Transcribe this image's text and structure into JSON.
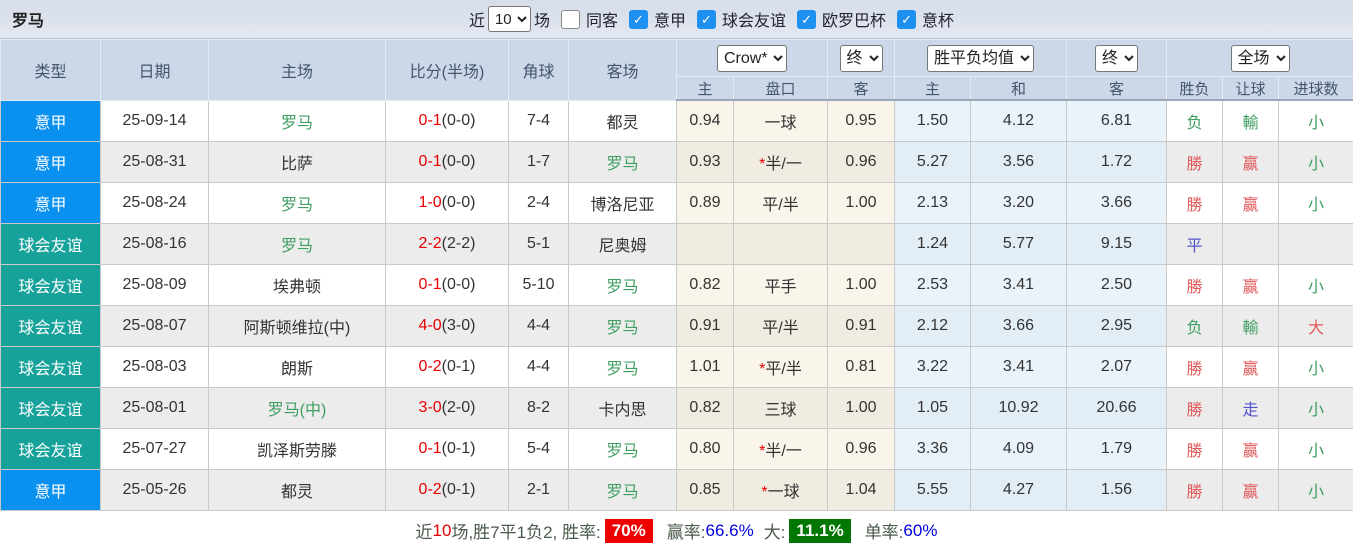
{
  "top": {
    "title": "罗马",
    "recent_label": "近",
    "recent_value": "10",
    "matches_label": "场",
    "filters": [
      {
        "label": "同客",
        "checked": false
      },
      {
        "label": "意甲",
        "checked": true
      },
      {
        "label": "球会友谊",
        "checked": true
      },
      {
        "label": "欧罗巴杯",
        "checked": true
      },
      {
        "label": "意杯",
        "checked": true
      }
    ]
  },
  "header": {
    "cols": [
      "类型",
      "日期",
      "主场",
      "比分(半场)",
      "角球",
      "客场"
    ],
    "selects": {
      "company": "Crow*",
      "time1": "终",
      "avg": "胜平负均值",
      "time2": "终",
      "scope": "全场"
    },
    "sub": [
      "主",
      "盘口",
      "客",
      "主",
      "和",
      "客",
      "胜负",
      "让球",
      "进球数"
    ]
  },
  "colors": {
    "serie_a": "#0a90ee",
    "friendly": "#16a29a",
    "win_red": "#e05858",
    "loss_green": "#3e9e60",
    "draw_blue": "#5353cc",
    "score_red": "#e80000",
    "badge_red": "#ee0000",
    "badge_green": "#007700"
  },
  "rows": [
    {
      "league": "意甲",
      "league_type": "serie",
      "date": "25-09-14",
      "home": "罗马",
      "home_color": "green",
      "score": "0-1",
      "half": "(0-0)",
      "corner": "7-4",
      "away": "都灵",
      "away_color": "dark",
      "o_home": "0.94",
      "hcap_star": "",
      "hcap": "一球",
      "o_away": "0.95",
      "avg_home": "1.50",
      "avg_draw": "4.12",
      "avg_away": "6.81",
      "result": "负",
      "result_color": "green",
      "hresult": "輸",
      "hresult_color": "green",
      "goal": "小",
      "goal_color": "green"
    },
    {
      "league": "意甲",
      "league_type": "serie",
      "date": "25-08-31",
      "home": "比萨",
      "home_color": "dark",
      "score": "0-1",
      "half": "(0-0)",
      "corner": "1-7",
      "away": "罗马",
      "away_color": "green",
      "o_home": "0.93",
      "hcap_star": "*",
      "hcap": "半/一",
      "o_away": "0.96",
      "avg_home": "5.27",
      "avg_draw": "3.56",
      "avg_away": "1.72",
      "result": "勝",
      "result_color": "red",
      "hresult": "赢",
      "hresult_color": "red",
      "goal": "小",
      "goal_color": "green"
    },
    {
      "league": "意甲",
      "league_type": "serie",
      "date": "25-08-24",
      "home": "罗马",
      "home_color": "green",
      "score": "1-0",
      "half": "(0-0)",
      "corner": "2-4",
      "away": "博洛尼亚",
      "away_color": "dark",
      "o_home": "0.89",
      "hcap_star": "",
      "hcap": "平/半",
      "o_away": "1.00",
      "avg_home": "2.13",
      "avg_draw": "3.20",
      "avg_away": "3.66",
      "result": "勝",
      "result_color": "red",
      "hresult": "赢",
      "hresult_color": "red",
      "goal": "小",
      "goal_color": "green"
    },
    {
      "league": "球会友谊",
      "league_type": "friendly",
      "date": "25-08-16",
      "home": "罗马",
      "home_color": "green",
      "score": "2-2",
      "half": "(2-2)",
      "corner": "5-1",
      "away": "尼奥姆",
      "away_color": "dark",
      "o_home": "",
      "hcap_star": "",
      "hcap": "",
      "o_away": "",
      "avg_home": "1.24",
      "avg_draw": "5.77",
      "avg_away": "9.15",
      "result": "平",
      "result_color": "blue",
      "hresult": "",
      "hresult_color": "dark",
      "goal": "",
      "goal_color": "dark"
    },
    {
      "league": "球会友谊",
      "league_type": "friendly",
      "date": "25-08-09",
      "home": "埃弗顿",
      "home_color": "dark",
      "score": "0-1",
      "half": "(0-0)",
      "corner": "5-10",
      "away": "罗马",
      "away_color": "green",
      "o_home": "0.82",
      "hcap_star": "",
      "hcap": "平手",
      "o_away": "1.00",
      "avg_home": "2.53",
      "avg_draw": "3.41",
      "avg_away": "2.50",
      "result": "勝",
      "result_color": "red",
      "hresult": "赢",
      "hresult_color": "red",
      "goal": "小",
      "goal_color": "green"
    },
    {
      "league": "球会友谊",
      "league_type": "friendly",
      "date": "25-08-07",
      "home": "阿斯顿维拉(中)",
      "home_color": "dark",
      "score": "4-0",
      "half": "(3-0)",
      "corner": "4-4",
      "away": "罗马",
      "away_color": "green",
      "o_home": "0.91",
      "hcap_star": "",
      "hcap": "平/半",
      "o_away": "0.91",
      "avg_home": "2.12",
      "avg_draw": "3.66",
      "avg_away": "2.95",
      "result": "负",
      "result_color": "green",
      "hresult": "輸",
      "hresult_color": "green",
      "goal": "大",
      "goal_color": "red"
    },
    {
      "league": "球会友谊",
      "league_type": "friendly",
      "date": "25-08-03",
      "home": "朗斯",
      "home_color": "dark",
      "score": "0-2",
      "half": "(0-1)",
      "corner": "4-4",
      "away": "罗马",
      "away_color": "green",
      "o_home": "1.01",
      "hcap_star": "*",
      "hcap": "平/半",
      "o_away": "0.81",
      "avg_home": "3.22",
      "avg_draw": "3.41",
      "avg_away": "2.07",
      "result": "勝",
      "result_color": "red",
      "hresult": "赢",
      "hresult_color": "red",
      "goal": "小",
      "goal_color": "green"
    },
    {
      "league": "球会友谊",
      "league_type": "friendly",
      "date": "25-08-01",
      "home": "罗马(中)",
      "home_color": "green",
      "score": "3-0",
      "half": "(2-0)",
      "corner": "8-2",
      "away": "卡内思",
      "away_color": "dark",
      "o_home": "0.82",
      "hcap_star": "",
      "hcap": "三球",
      "o_away": "1.00",
      "avg_home": "1.05",
      "avg_draw": "10.92",
      "avg_away": "20.66",
      "result": "勝",
      "result_color": "red",
      "hresult": "走",
      "hresult_color": "blue",
      "goal": "小",
      "goal_color": "green"
    },
    {
      "league": "球会友谊",
      "league_type": "friendly",
      "date": "25-07-27",
      "home": "凯泽斯劳滕",
      "home_color": "dark",
      "score": "0-1",
      "half": "(0-1)",
      "corner": "5-4",
      "away": "罗马",
      "away_color": "green",
      "o_home": "0.80",
      "hcap_star": "*",
      "hcap": "半/一",
      "o_away": "0.96",
      "avg_home": "3.36",
      "avg_draw": "4.09",
      "avg_away": "1.79",
      "result": "勝",
      "result_color": "red",
      "hresult": "赢",
      "hresult_color": "red",
      "goal": "小",
      "goal_color": "green"
    },
    {
      "league": "意甲",
      "league_type": "serie",
      "date": "25-05-26",
      "home": "都灵",
      "home_color": "dark",
      "score": "0-2",
      "half": "(0-1)",
      "corner": "2-1",
      "away": "罗马",
      "away_color": "green",
      "o_home": "0.85",
      "hcap_star": "*",
      "hcap": "一球",
      "o_away": "1.04",
      "avg_home": "5.55",
      "avg_draw": "4.27",
      "avg_away": "1.56",
      "result": "勝",
      "result_color": "red",
      "hresult": "赢",
      "hresult_color": "red",
      "goal": "小",
      "goal_color": "green"
    }
  ],
  "footer": {
    "prefix": "近",
    "recent_num": "10",
    "stats_text": "场,胜7平1负2, 胜率:",
    "win_rate": "70%",
    "win_label": "赢率:",
    "win_value": "66.6%",
    "big_label": "大:",
    "big_value": "11.1%",
    "single_label": "单率:",
    "single_value": "60%"
  }
}
